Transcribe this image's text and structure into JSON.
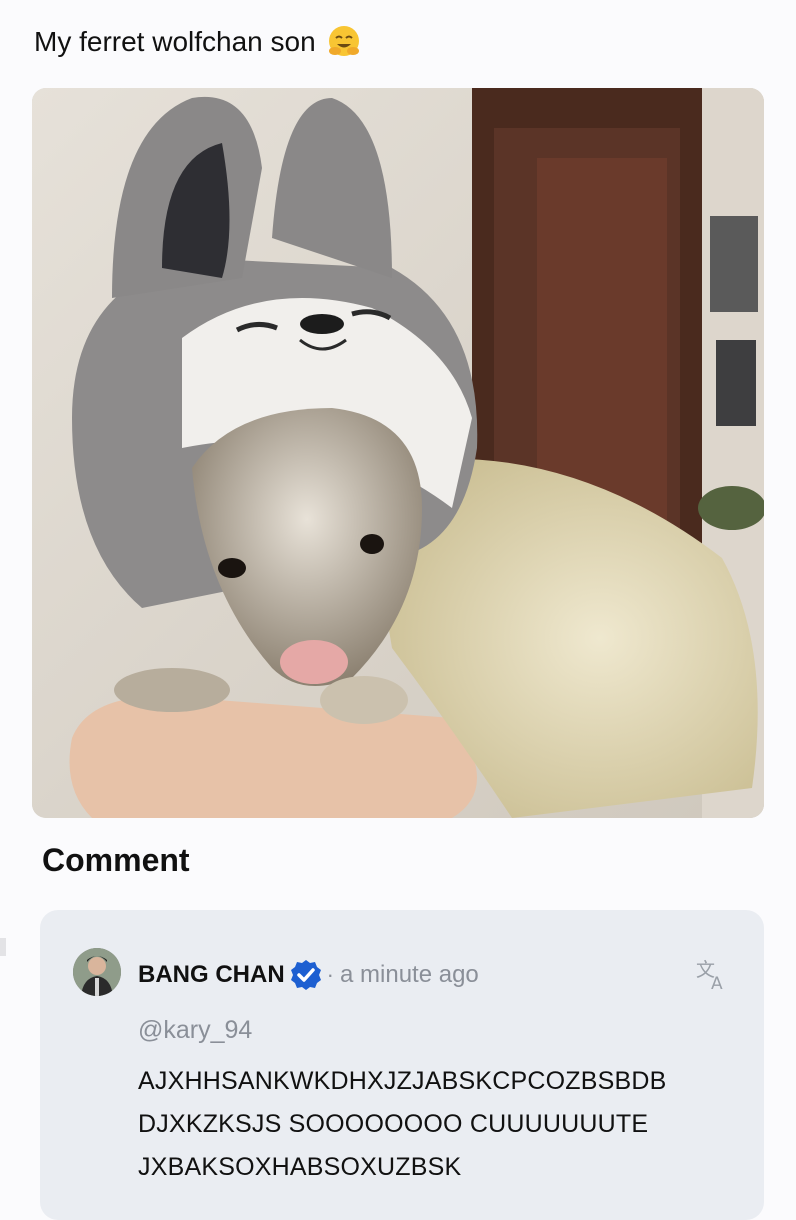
{
  "post": {
    "text": "My ferret wolfchan son",
    "emoji_icon": "hugging-face-emoji"
  },
  "photo": {
    "alt_subject": "ferret in wolf hood"
  },
  "comments_section": {
    "title": "Comment"
  },
  "comment": {
    "author": "BANG CHAN",
    "verified_icon": "verified-badge-icon",
    "separator": "·",
    "timestamp": "a minute ago",
    "translate_icon": "translate-icon",
    "mention": "@kary_94",
    "lines": [
      "AJXHHSANKWKDHXJZJABSKCPCOZBSBDB",
      "DJXKZKSJS SOOOOOOOO CUUUUUUUTE",
      "JXBAKSOXHABSOXUZBSK"
    ]
  },
  "colors": {
    "background": "#fbfbfd",
    "card": "#eaedf2",
    "muted_text": "#8a8f98",
    "verified_blue": "#1d5fd1"
  }
}
